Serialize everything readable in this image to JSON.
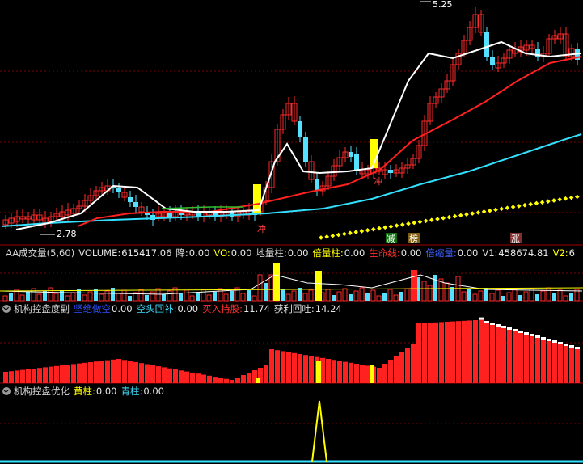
{
  "colors": {
    "bg": "#000000",
    "up": "#ff2a2a",
    "down": "#54e0ff",
    "white": "#ffffff",
    "yellow": "#ffff00",
    "cyan": "#34e0ff",
    "red": "#ff2020",
    "grid": "#7a0000",
    "blue": "#3366ff"
  },
  "main": {
    "high_label": "5.25",
    "low_label": "2.78",
    "signals": [
      {
        "label": "冲",
        "color": "#ff4040"
      },
      {
        "label": "冲",
        "color": "#ff4040"
      },
      {
        "label": "减",
        "bg": "#107010",
        "color": "#ffffff"
      },
      {
        "label": "榜",
        "bg": "#806010",
        "color": "#ffffff"
      },
      {
        "label": "涨",
        "bg": "#803030",
        "color": "#ffffff"
      }
    ]
  },
  "panel_volume": {
    "title": "AA成交量(5,60)",
    "items": [
      {
        "label": "VOLUME:",
        "value": "615417.06",
        "color": "#e0e0e0"
      },
      {
        "label": "降:",
        "value": "0.00",
        "color": "#e0e0e0"
      },
      {
        "label": "VO:",
        "value": "0.00",
        "color": "#ffff00"
      },
      {
        "label": "地量柱:",
        "value": "0.00",
        "color": "#e0e0e0"
      },
      {
        "label": "倍量柱:",
        "value": "0.00",
        "color": "#ffff00"
      },
      {
        "label": "生命线:",
        "value": "0.00",
        "color": "#ff3030"
      },
      {
        "label": "倍缩量:",
        "value": "0.00",
        "color": "#4060ff"
      },
      {
        "label": "V1:",
        "value": "458674.81",
        "color": "#e0e0e0"
      },
      {
        "label": "V2:",
        "value": "6",
        "color": "#ffff00"
      }
    ]
  },
  "panel_control": {
    "title": "机构控盘度副",
    "items": [
      {
        "label": "坚绝做空",
        "value": "0.00",
        "color": "#3050ff"
      },
      {
        "label": "空头回补:",
        "value": "0.00",
        "color": "#40e0ff"
      },
      {
        "label": "买入持股:",
        "value": "11.74",
        "color": "#ff3030"
      },
      {
        "label": "获利回吐:",
        "value": "14.24",
        "color": "#e0e0e0"
      }
    ]
  },
  "panel_opt": {
    "title": "机构控盘优化",
    "items": [
      {
        "label": "黄柱:",
        "value": "0.00",
        "color": "#ffff00"
      },
      {
        "label": "青柱:",
        "value": "0.00",
        "color": "#40e0ff"
      }
    ]
  }
}
